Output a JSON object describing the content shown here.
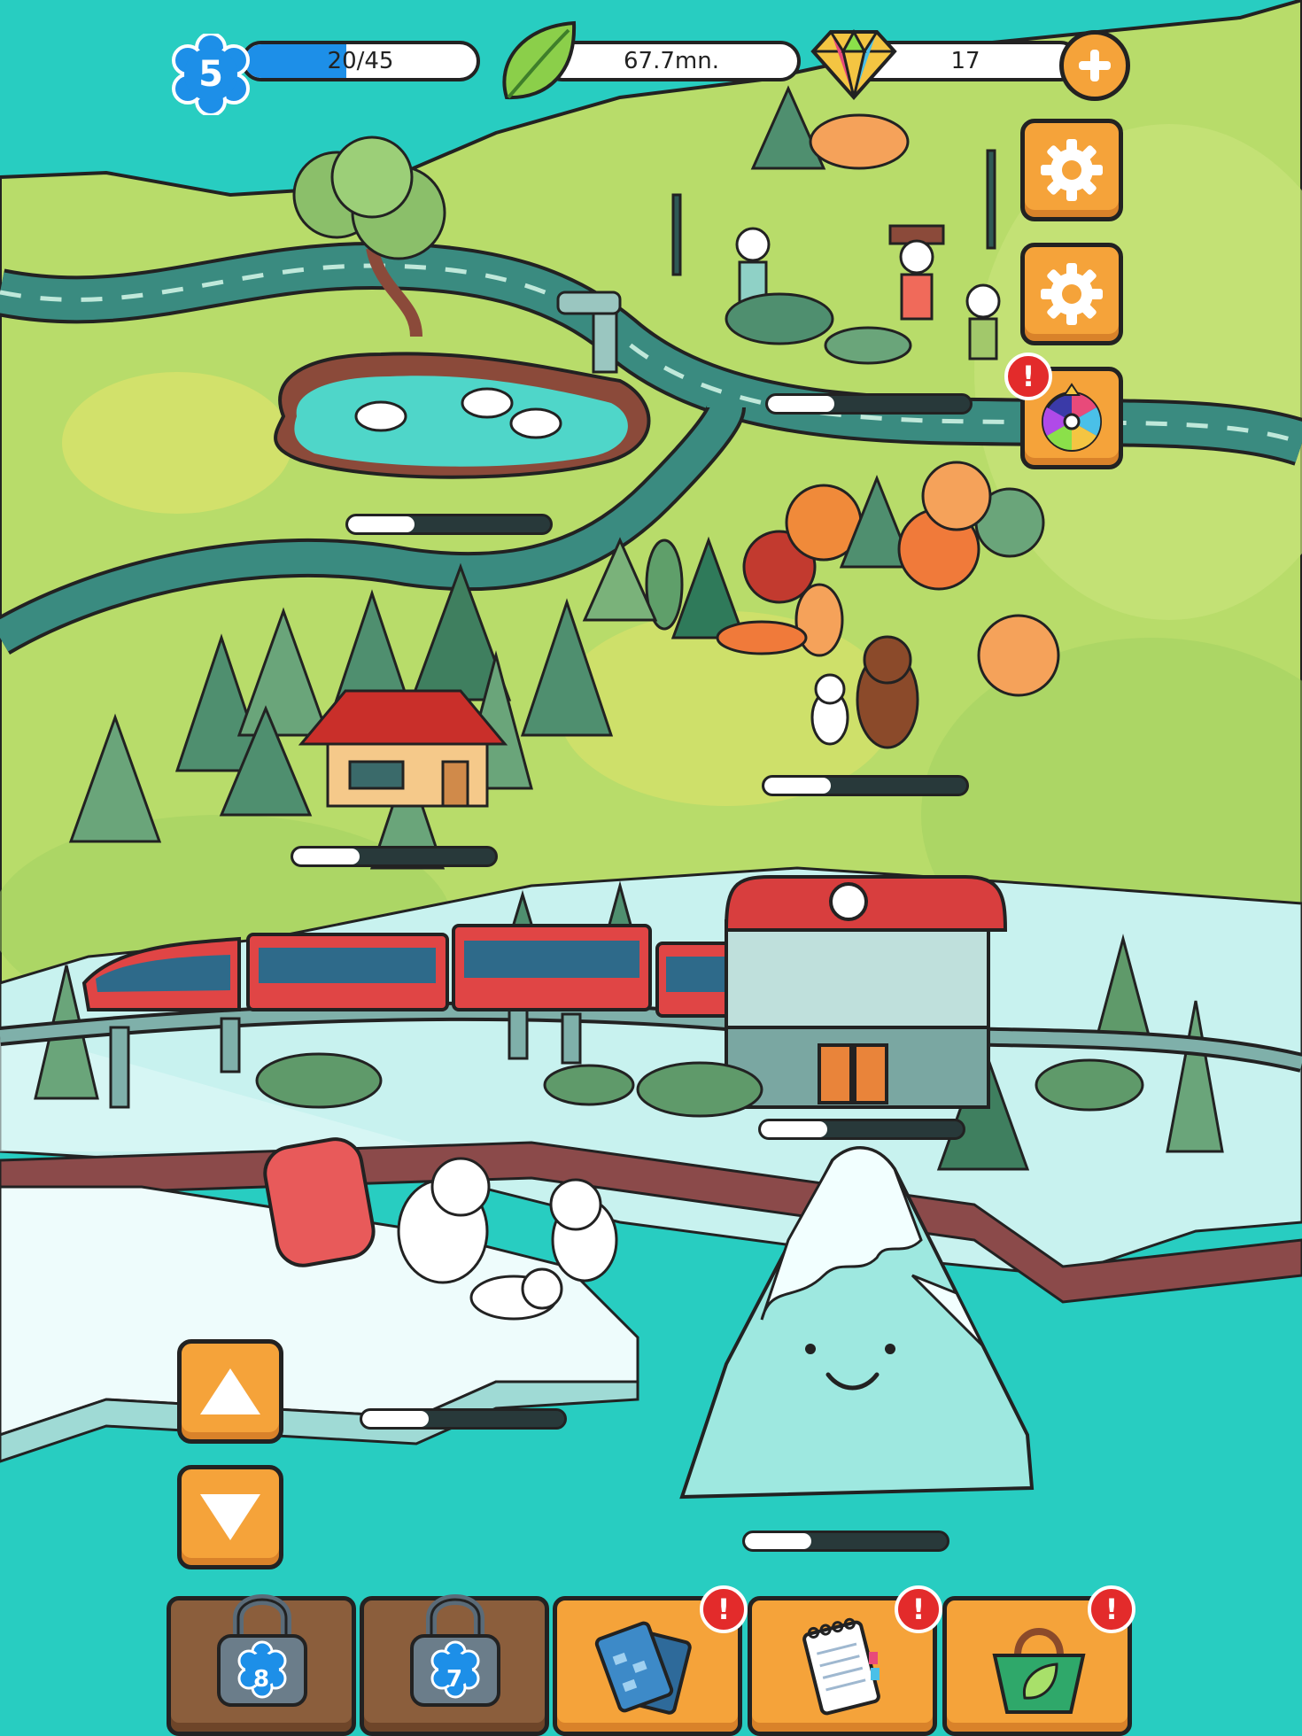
{
  "hud": {
    "level": {
      "value": "5",
      "progress_text": "20/45",
      "progress_fraction": 0.44
    },
    "leaves": {
      "value": "67.7mn."
    },
    "gems": {
      "value": "17"
    }
  },
  "icons": {
    "level_badge": "blue-flower-badge",
    "leaves": "green-leaf-icon",
    "gems": "rainbow-gem-icon",
    "add": "plus-icon",
    "settings": "gear-icon",
    "spin_wheel": "prize-wheel-icon",
    "alert": "exclamation-icon",
    "up": "arrow-up-icon",
    "down": "arrow-down-icon"
  },
  "alerts": {
    "mark": "!"
  },
  "zones": [
    {
      "id": "pond",
      "progress": 0.33
    },
    {
      "id": "park",
      "progress": 0.33
    },
    {
      "id": "forest",
      "progress": 0.33
    },
    {
      "id": "autumn-woods",
      "progress": 0.33
    },
    {
      "id": "train-station",
      "progress": 0.33
    },
    {
      "id": "polar-bears",
      "progress": 0.33
    },
    {
      "id": "iceberg",
      "progress": 0.33
    }
  ],
  "bottom_bar": {
    "slots": [
      {
        "id": "locked-8",
        "locked": true,
        "lock_level": "8"
      },
      {
        "id": "locked-7",
        "locked": true,
        "lock_level": "7"
      },
      {
        "id": "cards",
        "locked": false,
        "icon": "cards-icon",
        "alert": true
      },
      {
        "id": "notebook",
        "locked": false,
        "icon": "notebook-icon",
        "alert": true
      },
      {
        "id": "shop-bag",
        "locked": false,
        "icon": "leaf-bag-icon",
        "alert": true
      }
    ]
  },
  "colors": {
    "water": "#28cdc1",
    "grass": "#b8dc6a",
    "road": "#3a8b80",
    "snow": "#e8fbfb",
    "button": "#f5a33a",
    "locked": "#8b5e3c",
    "alert": "#e32b2b",
    "level_blue": "#1d8fe8"
  }
}
